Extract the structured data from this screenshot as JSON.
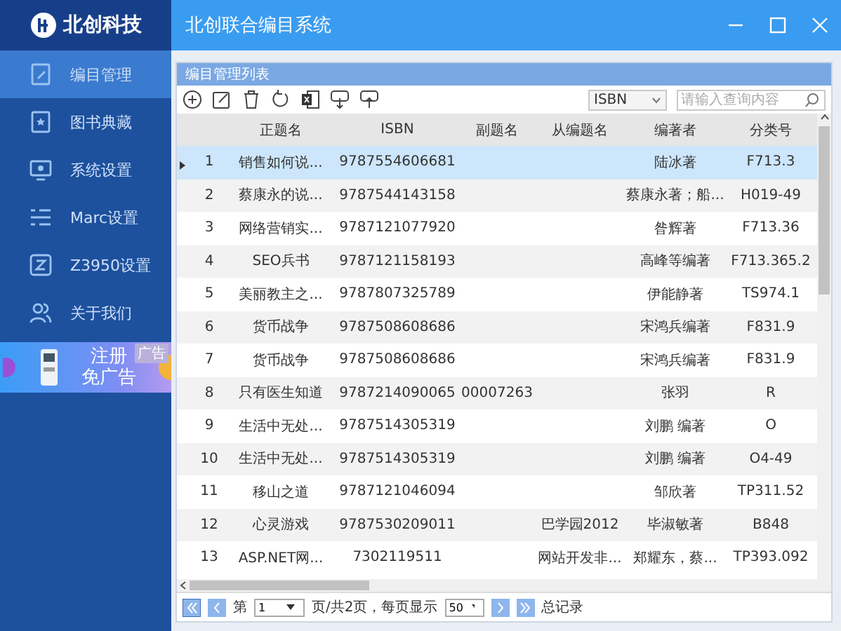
{
  "brand": {
    "name": "北创科技"
  },
  "window": {
    "title": "北创联合编目系统"
  },
  "sidebar": {
    "items": [
      {
        "label": "编目管理",
        "selected": true,
        "kind": "catalog"
      },
      {
        "label": "图书典藏",
        "selected": false,
        "kind": "collection"
      },
      {
        "label": "系统设置",
        "selected": false,
        "kind": "settings"
      },
      {
        "label": "Marc设置",
        "selected": false,
        "kind": "marc"
      },
      {
        "label": "Z3950设置",
        "selected": false,
        "kind": "z3950"
      },
      {
        "label": "关于我们",
        "selected": false,
        "kind": "about"
      }
    ],
    "ad": {
      "line_1": "注册",
      "line_2": "免广告",
      "tag": "广告"
    }
  },
  "panel": {
    "title": "编目管理列表"
  },
  "search": {
    "field": "ISBN",
    "placeholder": "请输入查询内容"
  },
  "table": {
    "columns": [
      "正题名",
      "ISBN",
      "副题名",
      "从编题名",
      "编著者",
      "分类号"
    ],
    "rows": [
      {
        "index": "1",
        "title": "销售如何说...",
        "isbn": "9787554606681",
        "author": "陆冰著",
        "class_no": "F713.3",
        "selected": true
      },
      {
        "index": "2",
        "title": "蔡康永的说...",
        "isbn": "9787544143158",
        "author": "蔡康永著；船...",
        "class_no": "H019-49",
        "selected": false
      },
      {
        "index": "3",
        "title": "网络营销实...",
        "isbn": "9787121077920",
        "author": "昝辉著",
        "class_no": "F713.36",
        "selected": false
      },
      {
        "index": "4",
        "title": "SEO兵书",
        "isbn": "9787121158193",
        "author": "高峰等编著",
        "class_no": "F713.365.2",
        "selected": false
      },
      {
        "index": "5",
        "title": "美丽教主之...",
        "isbn": "9787807325789",
        "author": "伊能静著",
        "class_no": "TS974.1",
        "selected": false
      },
      {
        "index": "6",
        "title": "货币战争",
        "isbn": "9787508608686",
        "author": "宋鸿兵编著",
        "class_no": "F831.9",
        "selected": false
      },
      {
        "index": "7",
        "title": "货币战争",
        "isbn": "9787508608686",
        "author": "宋鸿兵编著",
        "class_no": "F831.9",
        "selected": false
      },
      {
        "index": "8",
        "title": "只有医生知道",
        "isbn": "9787214090065",
        "subtitle": "00007263",
        "author": "张羽",
        "class_no": "R",
        "selected": false
      },
      {
        "index": "9",
        "title": "生活中无处...",
        "isbn": "9787514305319",
        "author": "刘鹏 编著",
        "class_no": "O",
        "selected": false
      },
      {
        "index": "10",
        "title": "生活中无处...",
        "isbn": "9787514305319",
        "author": "刘鹏 编著",
        "class_no": "O4-49",
        "selected": false
      },
      {
        "index": "11",
        "title": "移山之道",
        "isbn": "9787121046094",
        "author": "邹欣著",
        "class_no": "TP311.52",
        "selected": false
      },
      {
        "index": "12",
        "title": "心灵游戏",
        "isbn": "9787530209011",
        "series_title": "巴学园2012",
        "author": "毕淑敏著",
        "class_no": "B848",
        "selected": false
      },
      {
        "index": "13",
        "title": "ASP.NET网...",
        "isbn": "7302119511",
        "series_title": "网站开发非...",
        "author": "郑耀东，蔡...",
        "class_no": "TP393.092",
        "selected": false
      }
    ]
  },
  "pager": {
    "page_prefix": "第",
    "page": "1",
    "page_suffix": "页/共2页，每页显示",
    "page_size": "50",
    "total_label": "总记录"
  }
}
